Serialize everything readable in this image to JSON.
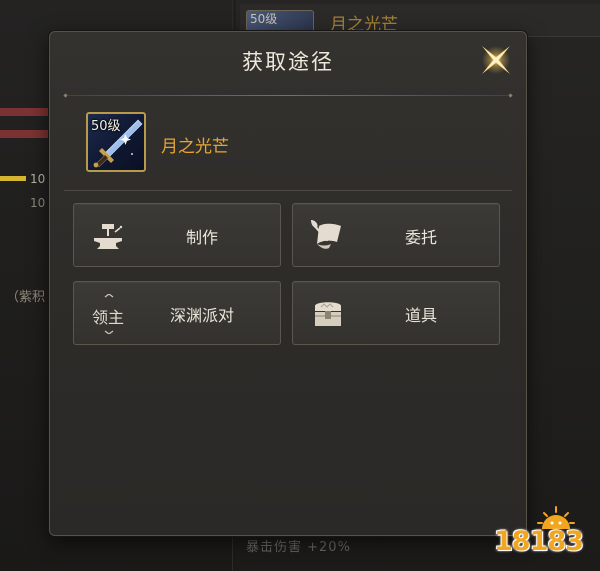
{
  "dialog": {
    "title": "获取途径"
  },
  "item": {
    "level_badge": "50级",
    "name": "月之光芒"
  },
  "actions": [
    {
      "label": "制作",
      "icon": "anvil-hammer-icon"
    },
    {
      "label": "委托",
      "icon": "scroll-quill-icon"
    },
    {
      "label": "深渊派对",
      "icon": "lord-badge-icon",
      "icon_text": "领主"
    },
    {
      "label": "道具",
      "icon": "treasure-chest-icon"
    }
  ],
  "background": {
    "item_chip": "50级",
    "item_title": "月之光芒",
    "bar_label_1": "10",
    "bar_label_2": "10",
    "paren_text": "（紫积",
    "bottom_text": "暴击伤害 +20%"
  },
  "watermark": {
    "text": "18183"
  },
  "colors": {
    "item_name": "#e7a532",
    "dialog_bg": "#2e2c29",
    "button_bg": "#3a3834",
    "close_icon": "#f3d27a"
  }
}
